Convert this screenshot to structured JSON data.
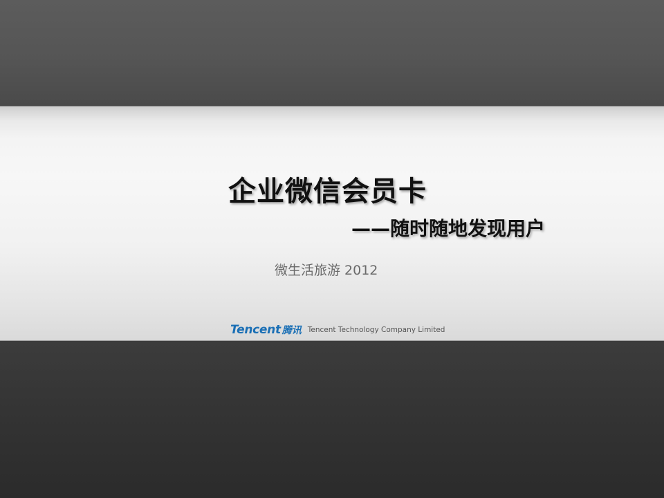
{
  "slide": {
    "title": "企业微信会员卡",
    "subtitle": "——随时随地发现用户",
    "meta": "微生活旅游 2012"
  },
  "footer": {
    "logo_text": "Tencent",
    "logo_cn": "腾讯",
    "company_name": "Tencent Technology Company Limited"
  },
  "colors": {
    "brand_blue": "#1a6fb5",
    "dark_band": "#555555",
    "light_band": "#f4f4f4"
  }
}
